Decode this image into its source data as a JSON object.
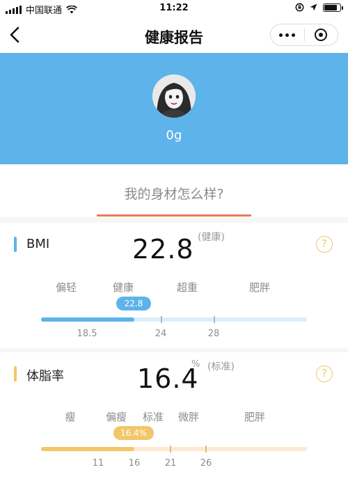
{
  "status_bar": {
    "carrier": "中国联通",
    "time": "11:22",
    "battery_level": 0.85
  },
  "nav": {
    "title": "健康报告"
  },
  "profile": {
    "weight": "0g"
  },
  "question": {
    "title": "我的身材怎么样?"
  },
  "bmi": {
    "label": "BMI",
    "value": "22.8",
    "status": "(健康)",
    "accent_color": "#5db3ea",
    "help": "?",
    "categories": [
      "偏轻",
      "健康",
      "超重",
      "肥胖"
    ],
    "badge": "22.8",
    "fill_fraction": 0.35,
    "ticks": [
      "18.5",
      "24",
      "28"
    ]
  },
  "body_fat": {
    "label": "体脂率",
    "value": "16.4",
    "unit": "%",
    "status": "(标准)",
    "accent_color": "#f2c66a",
    "help": "?",
    "categories": [
      "瘦",
      "偏瘦",
      "标准",
      "微胖",
      "肥胖"
    ],
    "badge": "16.4%",
    "fill_fraction": 0.35,
    "ticks": [
      "11",
      "16",
      "21",
      "26"
    ]
  }
}
